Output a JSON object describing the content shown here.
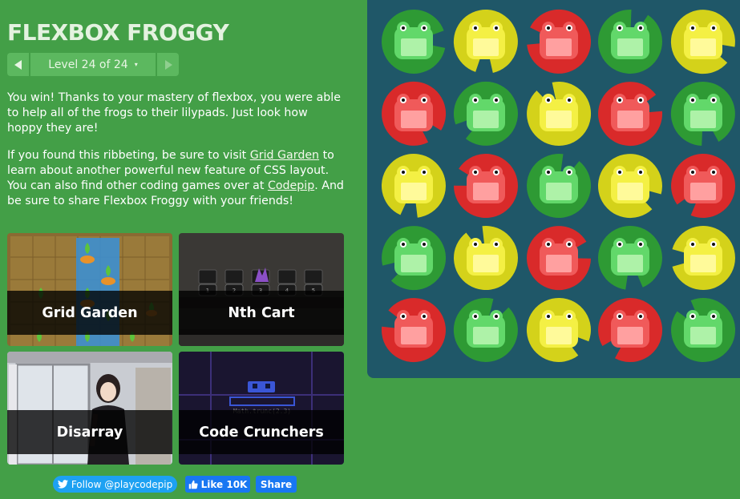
{
  "header": {
    "title": "FLEXBOX FROGGY"
  },
  "level_nav": {
    "label": "Level 24 of 24",
    "caret": "▾"
  },
  "intro": {
    "text": "You win! Thanks to your mastery of flexbox, you were able to help all of the frogs to their lilypads. Just look how hoppy they are!"
  },
  "more": {
    "part1": "If you found this ribbeting, be sure to visit ",
    "link1": "Grid Garden",
    "part2": " to learn about another powerful new feature of CSS layout. You can also find other coding games over at ",
    "link2": "Codepip",
    "part3": ". And be sure to share Flexbox Froggy with your friends!"
  },
  "games": [
    {
      "name": "Grid Garden"
    },
    {
      "name": "Nth Cart"
    },
    {
      "name": "Disarray"
    },
    {
      "name": "Code Crunchers",
      "code_text": "Math.trunc(2.3)"
    }
  ],
  "nth_cart_numbers": [
    "1",
    "2",
    "3",
    "4",
    "5"
  ],
  "social": {
    "twitter": "Follow @playcodepip",
    "like": "Like 10K",
    "share": "Share"
  },
  "colors": {
    "background": "#439f47",
    "pond": "#1f5768",
    "green_pad": "#2e9a34",
    "green_frog": "#62d86a",
    "yellow_pad": "#d4d21a",
    "yellow_frog": "#f4f044",
    "red_pad": "#d92a2a",
    "red_frog": "#f05a5a"
  },
  "board": {
    "rows": [
      [
        "green",
        "yellow",
        "red",
        "green",
        "yellow"
      ],
      [
        "red",
        "green",
        "yellow",
        "red",
        "green"
      ],
      [
        "yellow",
        "red",
        "green",
        "yellow",
        "red"
      ],
      [
        "green",
        "yellow",
        "red",
        "green",
        "yellow"
      ],
      [
        "red",
        "green",
        "yellow",
        "red",
        "green"
      ]
    ]
  }
}
